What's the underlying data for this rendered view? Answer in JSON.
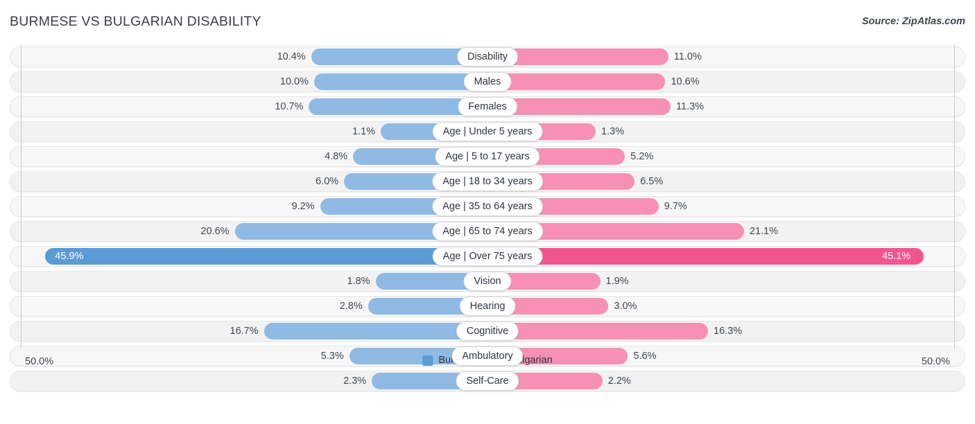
{
  "header": {
    "title": "BURMESE VS BULGARIAN DISABILITY",
    "source": "Source: ZipAtlas.com"
  },
  "axis": {
    "left_label": "50.0%",
    "right_label": "50.0%"
  },
  "legend": {
    "items": [
      {
        "label": "Burmese",
        "color": "#5b9bd5"
      },
      {
        "label": "Bulgarian",
        "color": "#f0558b"
      }
    ]
  },
  "chart_data": {
    "type": "bar",
    "subtype": "diverging-bidirectional",
    "title": "BURMESE VS BULGARIAN DISABILITY",
    "xlabel": "",
    "ylabel": "",
    "xlim": [
      50.0,
      50.0
    ],
    "grid": false,
    "legend_position": "bottom-center",
    "categories": [
      "Disability",
      "Males",
      "Females",
      "Age | Under 5 years",
      "Age | 5 to 17 years",
      "Age | 18 to 34 years",
      "Age | 35 to 64 years",
      "Age | 65 to 74 years",
      "Age | Over 75 years",
      "Vision",
      "Hearing",
      "Cognitive",
      "Ambulatory",
      "Self-Care"
    ],
    "series": [
      {
        "name": "Burmese",
        "color": "#8fbae3",
        "values": [
          10.4,
          10.0,
          10.7,
          1.1,
          4.8,
          6.0,
          9.2,
          20.6,
          45.9,
          1.8,
          2.8,
          16.7,
          5.3,
          2.3
        ],
        "labels": [
          "10.4%",
          "10.0%",
          "10.7%",
          "1.1%",
          "4.8%",
          "6.0%",
          "9.2%",
          "20.6%",
          "45.9%",
          "1.8%",
          "2.8%",
          "16.7%",
          "5.3%",
          "2.3%"
        ]
      },
      {
        "name": "Bulgarian",
        "color": "#f690b4",
        "values": [
          11.0,
          10.6,
          11.3,
          1.3,
          5.2,
          6.5,
          9.7,
          21.1,
          45.1,
          1.9,
          3.0,
          16.3,
          5.6,
          2.2
        ],
        "labels": [
          "11.0%",
          "10.6%",
          "11.3%",
          "1.3%",
          "5.2%",
          "6.5%",
          "9.7%",
          "21.1%",
          "45.1%",
          "1.9%",
          "3.0%",
          "16.3%",
          "5.6%",
          "2.2%"
        ]
      }
    ],
    "highlighted_row_index": 8
  }
}
